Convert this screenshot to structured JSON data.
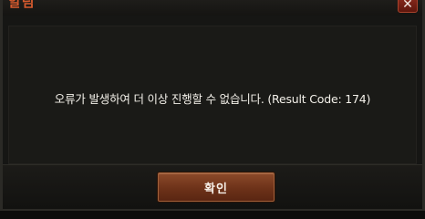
{
  "dialog": {
    "title": "알림",
    "close_icon": "close-icon",
    "message": "오류가 발생하여 더 이상 진행할 수 없습니다. (Result Code: 174)",
    "confirm_label": "확인"
  },
  "colors": {
    "title": "#d65a2e",
    "close_button": "#7a2316",
    "confirm_button": "#6d3219",
    "background": "#161614"
  }
}
